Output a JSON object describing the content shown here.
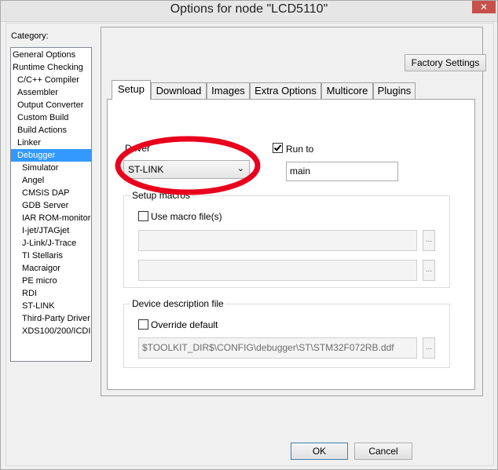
{
  "window": {
    "title": "Options for node \"LCD5110\""
  },
  "category": {
    "label": "Category:",
    "items": [
      {
        "label": "General Options"
      },
      {
        "label": "Runtime Checking"
      },
      {
        "label": "C/C++ Compiler"
      },
      {
        "label": "Assembler"
      },
      {
        "label": "Output Converter"
      },
      {
        "label": "Custom Build"
      },
      {
        "label": "Build Actions"
      },
      {
        "label": "Linker"
      },
      {
        "label": "Debugger"
      },
      {
        "label": "Simulator"
      },
      {
        "label": "Angel"
      },
      {
        "label": "CMSIS DAP"
      },
      {
        "label": "GDB Server"
      },
      {
        "label": "IAR ROM-monitor"
      },
      {
        "label": "I-jet/JTAGjet"
      },
      {
        "label": "J-Link/J-Trace"
      },
      {
        "label": "TI Stellaris"
      },
      {
        "label": "Macraigor"
      },
      {
        "label": "PE micro"
      },
      {
        "label": "RDI"
      },
      {
        "label": "ST-LINK"
      },
      {
        "label": "Third-Party Driver"
      },
      {
        "label": "XDS100/200/ICDI"
      }
    ],
    "selected": "Debugger"
  },
  "factory_settings_label": "Factory Settings",
  "tabs": [
    {
      "label": "Setup"
    },
    {
      "label": "Download"
    },
    {
      "label": "Images"
    },
    {
      "label": "Extra Options"
    },
    {
      "label": "Multicore"
    },
    {
      "label": "Plugins"
    }
  ],
  "active_tab": "Setup",
  "setup": {
    "driver_label": "Driver",
    "driver_value": "ST-LINK",
    "run_to_label": "Run to",
    "run_to_checked": true,
    "run_to_value": "main",
    "setup_macros_label": "Setup macros",
    "use_macro_label": "Use macro file(s)",
    "use_macro_checked": false,
    "macro_browse_label": "...",
    "device_desc_label": "Device description file",
    "override_label": "Override default",
    "override_checked": false,
    "device_desc_path": "$TOOLKIT_DIR$\\CONFIG\\debugger\\ST\\STM32F072RB.ddf",
    "device_browse_label": "..."
  },
  "buttons": {
    "ok": "OK",
    "cancel": "Cancel"
  },
  "annotation": {
    "color": "#e8001c"
  },
  "colors": {
    "selection": "#3399ff",
    "close_button": "#c7504a"
  }
}
